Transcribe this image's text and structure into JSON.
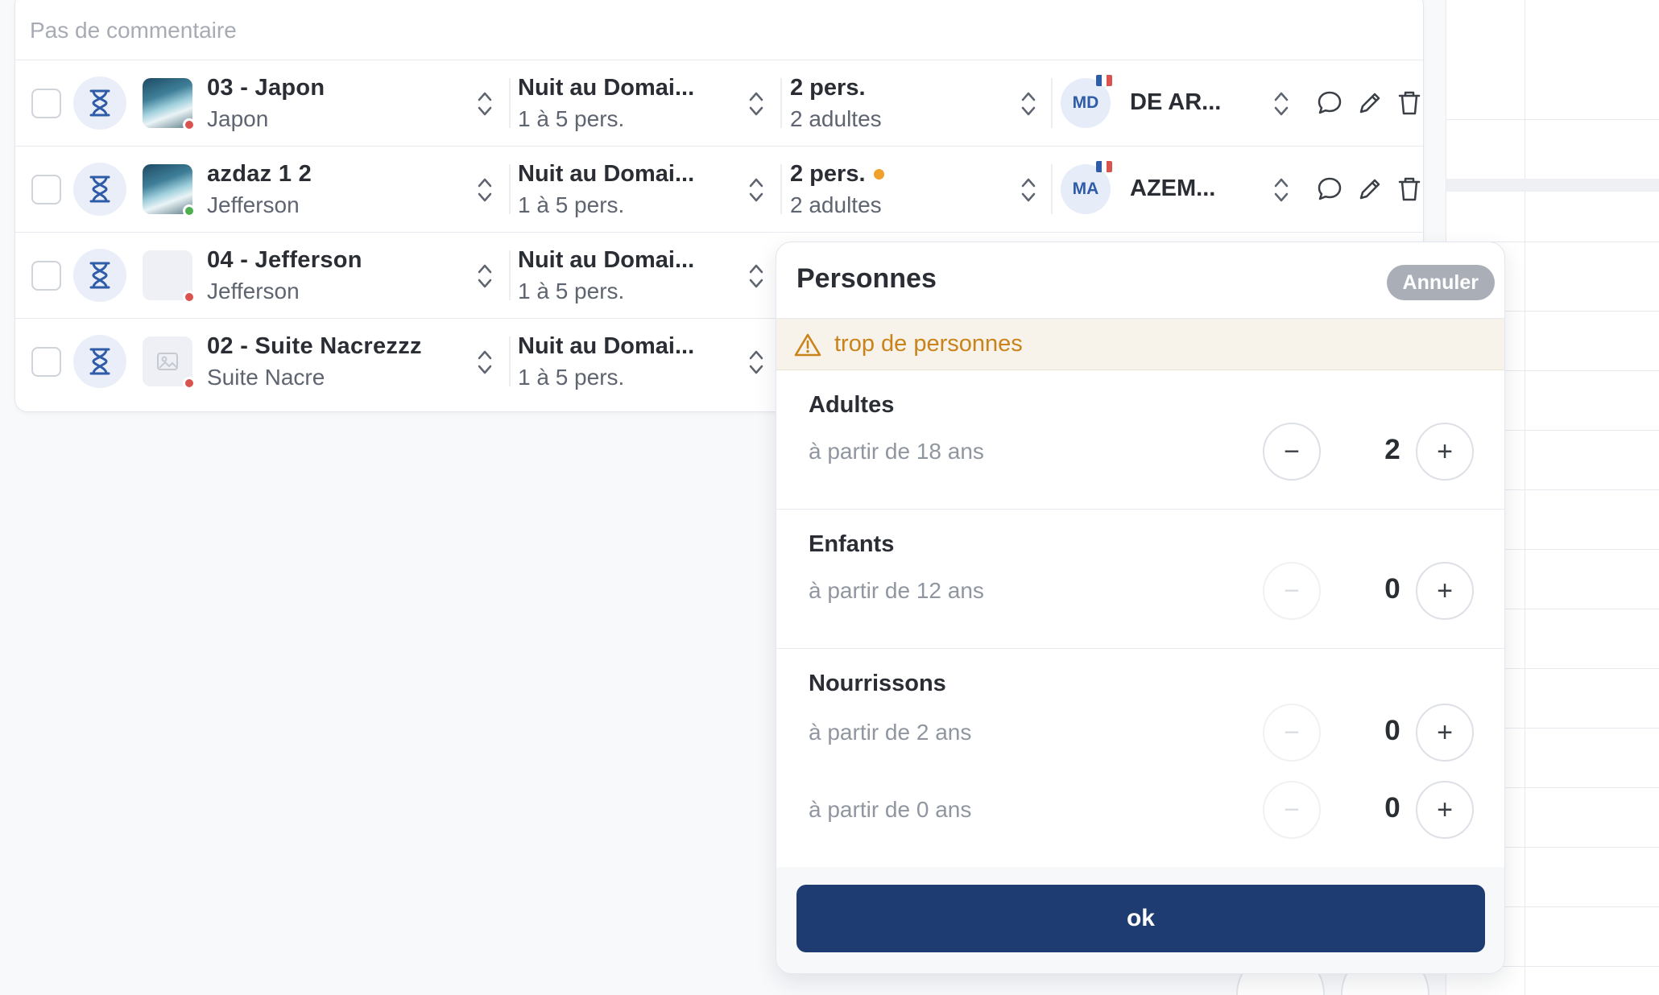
{
  "table": {
    "comment_placeholder": "Pas de commentaire",
    "rows": [
      {
        "name": "03 - Japon",
        "sub": "Japon",
        "rate": "Nuit au Domai...",
        "rate_sub": "1 à 5 pers.",
        "pers": "2 pers.",
        "pers_sub": "2 adultes",
        "avatar": "MD",
        "client": "DE AR..."
      },
      {
        "name": "azdaz 1 2",
        "sub": "Jefferson",
        "rate": "Nuit au Domai...",
        "rate_sub": "1 à 5 pers.",
        "pers": "2 pers.",
        "pers_sub": "2 adultes",
        "avatar": "MA",
        "client": "AZEM..."
      },
      {
        "name": "04 - Jefferson",
        "sub": "Jefferson",
        "rate": "Nuit au Domai...",
        "rate_sub": "1 à 5 pers."
      },
      {
        "name": "02 - Suite Nacrezzz",
        "sub": "Suite Nacre",
        "rate": "Nuit au Domai...",
        "rate_sub": "1 à 5 pers."
      }
    ]
  },
  "popover": {
    "title": "Personnes",
    "cancel_label": "Annuler",
    "warning": "trop de personnes",
    "sections": [
      {
        "label": "Adultes",
        "lines": [
          {
            "desc": "à partir de 18 ans",
            "value": "2"
          }
        ]
      },
      {
        "label": "Enfants",
        "lines": [
          {
            "desc": "à partir de 12 ans",
            "value": "0"
          }
        ]
      },
      {
        "label": "Nourrissons",
        "lines": [
          {
            "desc": "à partir de 2 ans",
            "value": "0"
          },
          {
            "desc": "à partir de 0 ans",
            "value": "0"
          }
        ]
      }
    ],
    "ok_label": "ok"
  },
  "colors": {
    "primary": "#1f3c72",
    "warning": "#c9831a",
    "status_red": "#d9534f",
    "status_green": "#4caf50",
    "pending_orange": "#f0a12c"
  },
  "icons": {
    "status": "hourglass-icon",
    "sort": "chevron-up-down-icon",
    "comment": "comment-icon",
    "edit": "pencil-icon",
    "delete": "trash-icon",
    "warning": "warning-triangle-icon"
  }
}
